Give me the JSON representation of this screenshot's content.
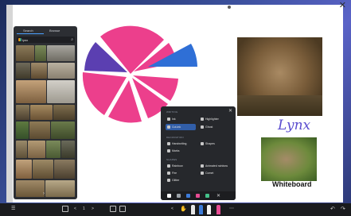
{
  "window": {
    "close_label": "✕"
  },
  "search_panel": {
    "tabs": [
      "Search",
      "Browse"
    ],
    "query": "lynx",
    "captions": [
      "",
      "",
      "",
      "",
      "",
      "",
      "",
      "",
      "",
      "",
      "",
      "",
      "",
      "",
      ""
    ]
  },
  "popup": {
    "sections": [
      "WRITING",
      "DECORATION",
      "SHAPES"
    ],
    "items": [
      "Ink",
      "Highlighter",
      "Cut-ink",
      "Ghost",
      "Handwriting",
      "Shapes",
      "Marks",
      "Rainbow",
      "Animated rainbow",
      "Fire",
      "Comet",
      "Glitter"
    ],
    "close": "✕",
    "toolbar_colors": [
      "#ffffff",
      "#9aa0a6",
      "#3d7bd9",
      "#e84c93",
      "#44c28a"
    ]
  },
  "canvas": {
    "handwriting": "Lynx",
    "caption": "Whiteboard",
    "pie_colors": {
      "pink": "#ec3f8c",
      "blue": "#2f6fd6",
      "purple": "#5b3fb1"
    }
  },
  "toolbar": {
    "left_icon": "grid-icon",
    "page": "1",
    "prev": "<",
    "next": ">",
    "back": "<",
    "undo": "↶",
    "redo": "↷"
  }
}
